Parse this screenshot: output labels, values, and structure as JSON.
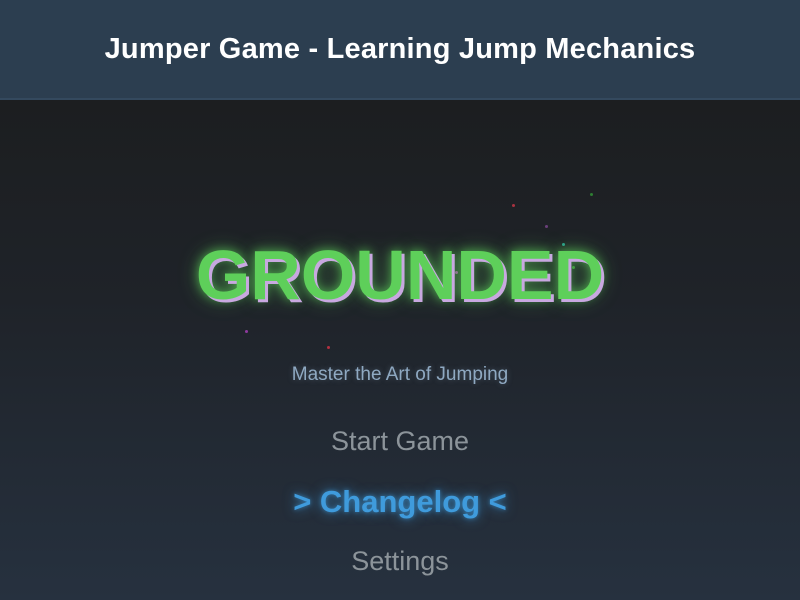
{
  "header": {
    "title": "Jumper Game - Learning Jump Mechanics"
  },
  "game": {
    "title": "GROUNDED",
    "subtitle": "Master the Art of Jumping",
    "menu": {
      "start_game": "Start Game",
      "changelog": "> Changelog <",
      "settings": "Settings"
    },
    "selected_menu_item": "Changelog",
    "colors": {
      "header_bg": "#2c3e50",
      "title_green": "#5ecf5a",
      "title_shadow": "#c8a8e0",
      "selected_blue": "#3f9bdc",
      "menu_gray": "#8c949a",
      "subtitle_blue": "#8fa9c2"
    }
  }
}
